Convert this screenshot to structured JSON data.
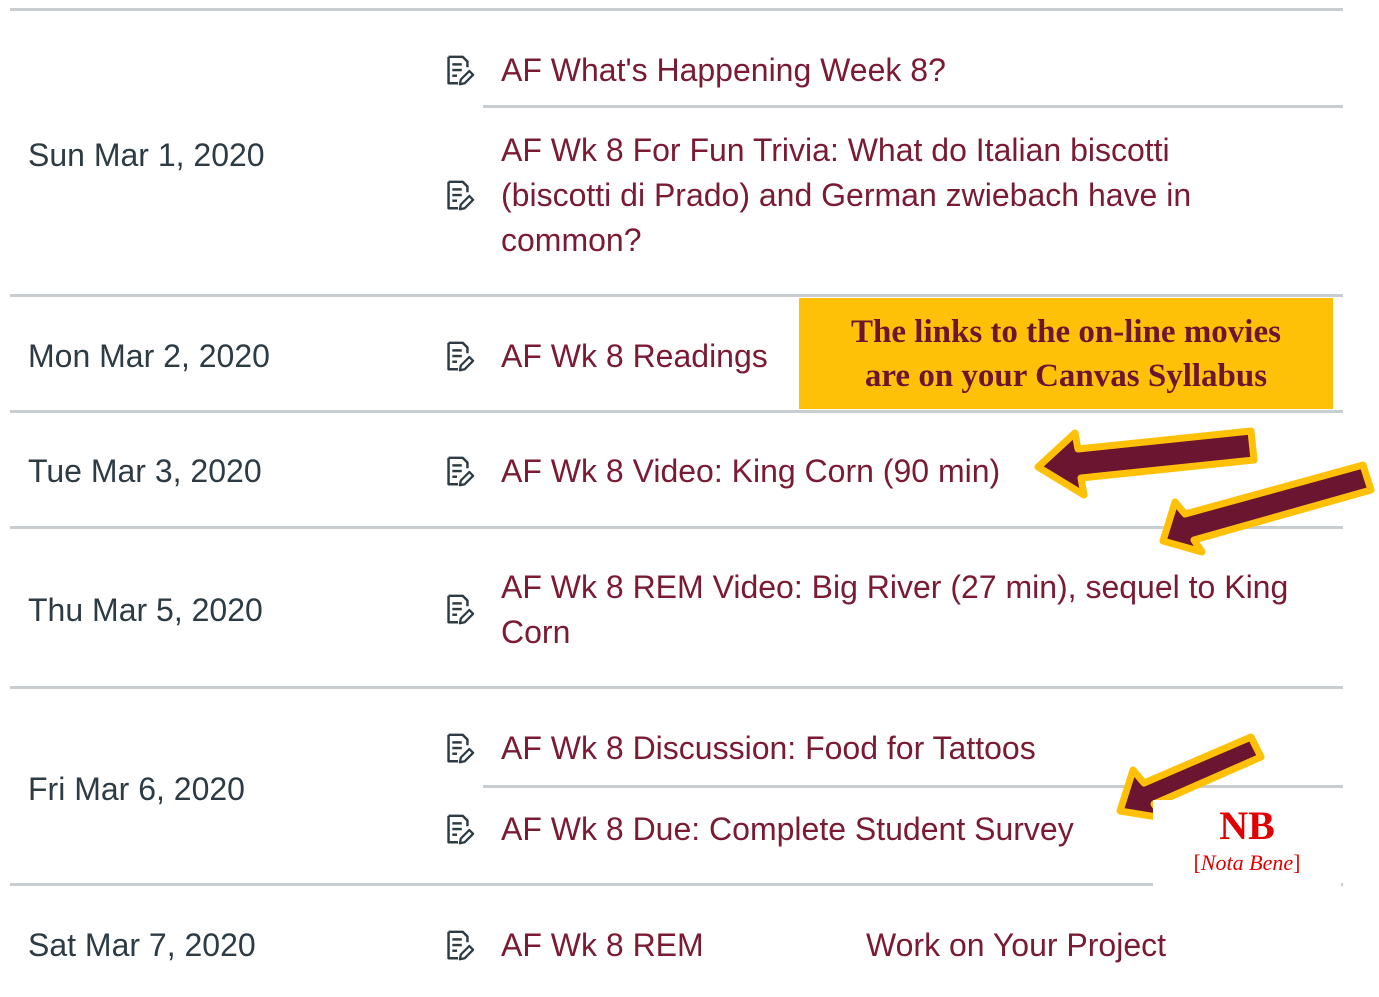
{
  "schedule": [
    {
      "date": "Sun Mar 1, 2020",
      "items": [
        {
          "label": "AF What's Happening Week 8?"
        },
        {
          "label": "AF Wk 8 For Fun Trivia: What do Italian biscotti (biscotti di Prado) and German zwiebach have in common?"
        }
      ]
    },
    {
      "date": "Mon Mar 2, 2020",
      "items": [
        {
          "label": "AF Wk 8 Readings"
        }
      ]
    },
    {
      "date": "Tue Mar 3, 2020",
      "items": [
        {
          "label": "AF Wk 8 Video: King Corn (90 min)"
        }
      ]
    },
    {
      "date": "Thu Mar 5, 2020",
      "items": [
        {
          "label": "AF Wk 8 REM Video: Big River (27 min), sequel to King Corn"
        }
      ]
    },
    {
      "date": "Fri Mar 6, 2020",
      "items": [
        {
          "label": "AF Wk 8 Discussion: Food for Tattoos"
        },
        {
          "label": "AF Wk 8 Due: Complete Student Survey"
        }
      ]
    },
    {
      "date": "Sat Mar 7, 2020",
      "items": [
        {
          "label": "AF Wk 8 REM"
        },
        {
          "label": "Work on Your Project"
        }
      ]
    }
  ],
  "callout": {
    "line1": "The links to the on-line movies",
    "line2": "are on your Canvas Syllabus"
  },
  "nb_note": {
    "title": "NB",
    "sub_open": "[",
    "sub_italic": "Nota Bene",
    "sub_close": "]"
  },
  "icon_name": "assignment-edit-icon",
  "colors": {
    "link": "#7a1a33",
    "date_text": "#2d3b45",
    "divider": "#c7cdd1",
    "callout_bg": "#ffc107",
    "callout_text": "#6b1530",
    "arrow_fill": "#6b1530",
    "arrow_outline": "#ffc107",
    "nb_red": "#e00000"
  }
}
